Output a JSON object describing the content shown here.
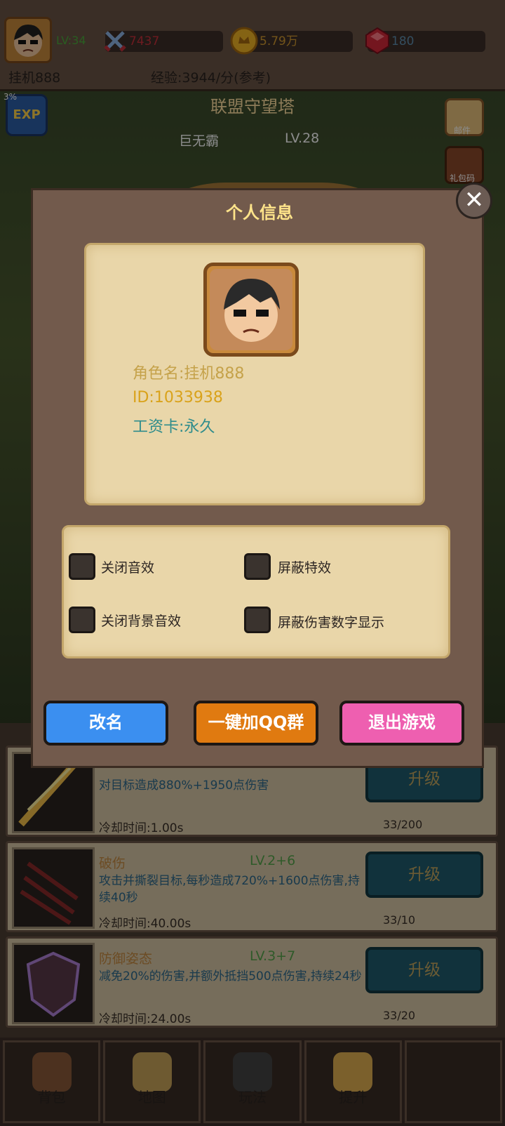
{
  "topbar": {
    "level": "LV:34",
    "power": "7437",
    "gold": "5.79万",
    "gems": "180",
    "player_name": "挂机888",
    "exp_rate": "经验:3944/分(参考)"
  },
  "area": {
    "title": "联盟守望塔",
    "boss": "巨无霸",
    "boss_level": "LV.28",
    "exp_badge": "3%",
    "exp_label": "EXP"
  },
  "side": {
    "mail": "邮件",
    "gift": "礼包码"
  },
  "modal": {
    "title": "个人信息",
    "role_name": "角色名:挂机888",
    "id": "ID:1033938",
    "salary_card": "工资卡:永久",
    "options": [
      "关闭音效",
      "屏蔽特效",
      "关闭背景音效",
      "屏蔽伤害数字显示"
    ],
    "buttons": {
      "rename": "改名",
      "qq_group": "一键加QQ群",
      "quit": "退出游戏"
    }
  },
  "skills": [
    {
      "name": "",
      "level": "",
      "desc": "对目标造成880%+1950点伤害",
      "cooldown": "冷却时间:1.00s",
      "upgrade": "升级",
      "cost": "33/200"
    },
    {
      "name": "破伤",
      "level": "LV.2+6",
      "desc": "攻击并撕裂目标,每秒造成720%+1600点伤害,持续40秒",
      "cooldown": "冷却时间:40.00s",
      "upgrade": "升级",
      "cost": "33/10"
    },
    {
      "name": "防御姿态",
      "level": "LV.3+7",
      "desc": "减免20%的伤害,并额外抵挡500点伤害,持续24秒",
      "cooldown": "冷却时间:24.00s",
      "upgrade": "升级",
      "cost": "33/20"
    }
  ],
  "nav": [
    "背包",
    "地图",
    "玩法",
    "提升",
    ""
  ],
  "colors": {
    "accent_gold": "#ffe48a",
    "rename_btn": "#3b8ff0",
    "qq_btn": "#e07a10",
    "quit_btn": "#ee5fb0"
  }
}
